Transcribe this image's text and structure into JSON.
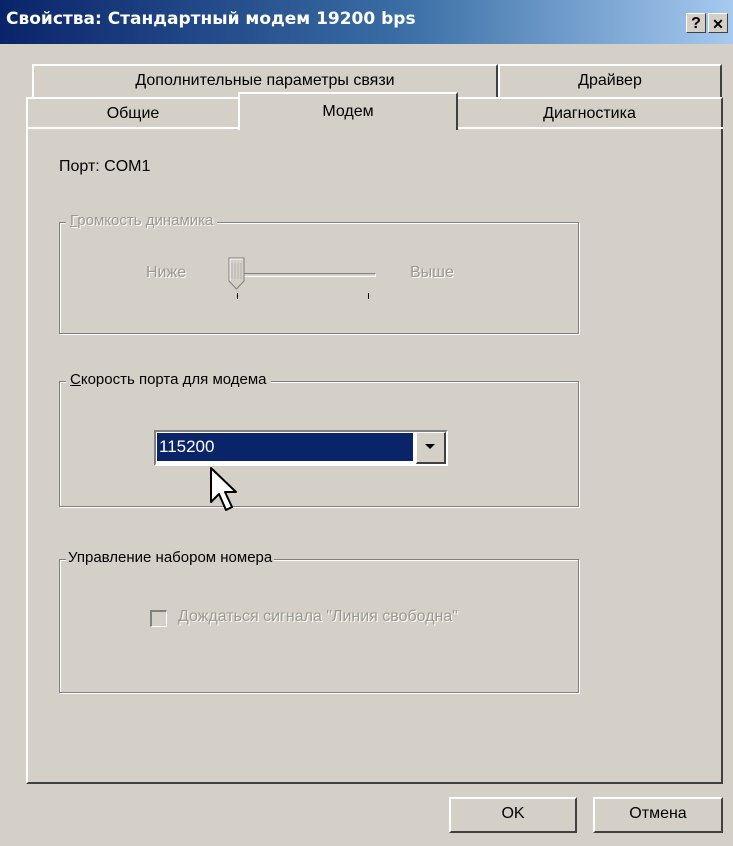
{
  "window": {
    "title": "Свойства: Стандартный модем 19200 bps",
    "help_glyph": "?",
    "close_glyph": "✕"
  },
  "tabs": {
    "row_back": [
      {
        "label": "Дополнительные параметры связи"
      },
      {
        "label": "Драйвер"
      }
    ],
    "row_front": [
      {
        "label": "Общие"
      },
      {
        "label": "Модем",
        "active": true
      },
      {
        "label": "Диагностика"
      }
    ]
  },
  "modem": {
    "port_label": "Порт:",
    "port_value": "COM1",
    "volume_group": {
      "title_accel": "Г",
      "title_rest": "ромкость динамика",
      "low_label": "Ниже",
      "high_label": "Выше",
      "level_fraction": 0.0,
      "enabled": false
    },
    "speed_group": {
      "title_accel": "С",
      "title_rest": "корость порта для модема",
      "selected_value": "115200"
    },
    "dial_group": {
      "title": "Управление набором номера",
      "checkbox_accel": "Д",
      "checkbox_rest": "ождаться сигнала \"Линия свободна\"",
      "checked": false,
      "enabled": false
    }
  },
  "buttons": {
    "ok": "OK",
    "cancel": "Отмена"
  },
  "colors": {
    "title_active": "#0a246a",
    "face": "#d4d0c8",
    "selection": "#0a246a"
  }
}
